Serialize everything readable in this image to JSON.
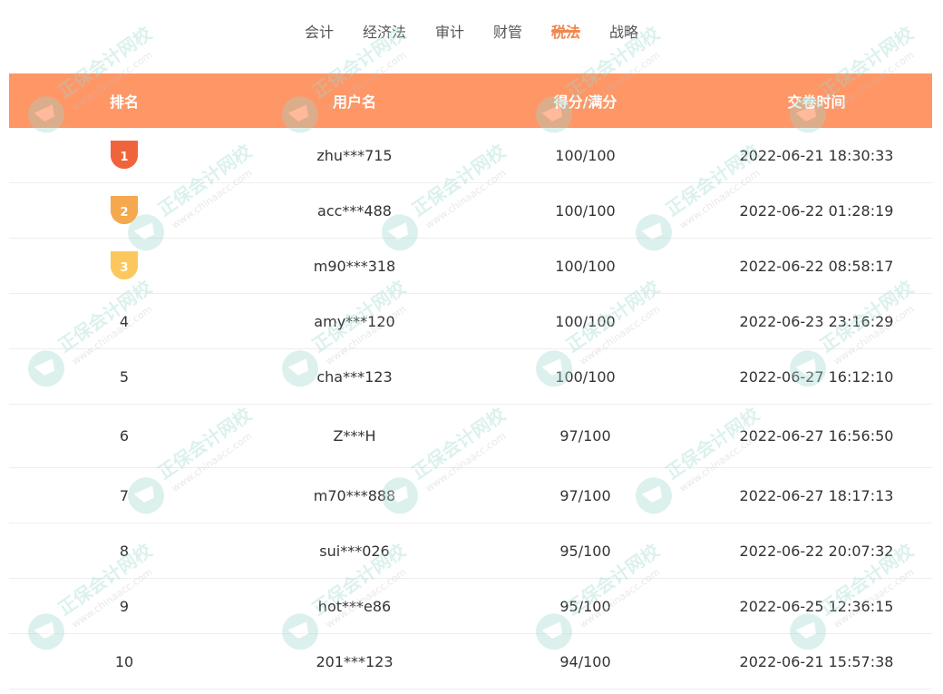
{
  "tabs": [
    {
      "label": "会计",
      "active": false
    },
    {
      "label": "经济法",
      "active": false
    },
    {
      "label": "审计",
      "active": false
    },
    {
      "label": "财管",
      "active": false
    },
    {
      "label": "税法",
      "active": true
    },
    {
      "label": "战略",
      "active": false
    }
  ],
  "table": {
    "headers": [
      "排名",
      "用户名",
      "得分/满分",
      "交卷时间"
    ],
    "rows": [
      {
        "rank": "1",
        "user": "zhu***715",
        "score": "100/100",
        "time": "2022-06-21 18:30:33"
      },
      {
        "rank": "2",
        "user": "acc***488",
        "score": "100/100",
        "time": "2022-06-22 01:28:19"
      },
      {
        "rank": "3",
        "user": "m90***318",
        "score": "100/100",
        "time": "2022-06-22 08:58:17"
      },
      {
        "rank": "4",
        "user": "amy***120",
        "score": "100/100",
        "time": "2022-06-23 23:16:29"
      },
      {
        "rank": "5",
        "user": "cha***123",
        "score": "100/100",
        "time": "2022-06-27 16:12:10"
      },
      {
        "rank": "6",
        "user": "Z***H",
        "score": "97/100",
        "time": "2022-06-27 16:56:50"
      },
      {
        "rank": "7",
        "user": "m70***888",
        "score": "97/100",
        "time": "2022-06-27 18:17:13"
      },
      {
        "rank": "8",
        "user": "sui***026",
        "score": "95/100",
        "time": "2022-06-22 20:07:32"
      },
      {
        "rank": "9",
        "user": "hot***e86",
        "score": "95/100",
        "time": "2022-06-25 12:36:15"
      },
      {
        "rank": "10",
        "user": "201***123",
        "score": "94/100",
        "time": "2022-06-21 15:57:38"
      }
    ]
  },
  "medal_colors": {
    "1": [
      "#f0643c",
      "#e84a2a"
    ],
    "2": [
      "#f6a84e",
      "#ee8a30"
    ],
    "3": [
      "#fcc85e",
      "#f6aa3c"
    ]
  },
  "colors": {
    "header_bg": "#ff9666",
    "accent": "#f08850"
  },
  "watermark": {
    "brand": "正保会计网校",
    "site": "www.chinaacc.com",
    "icon": "watermark-logo-icon"
  }
}
